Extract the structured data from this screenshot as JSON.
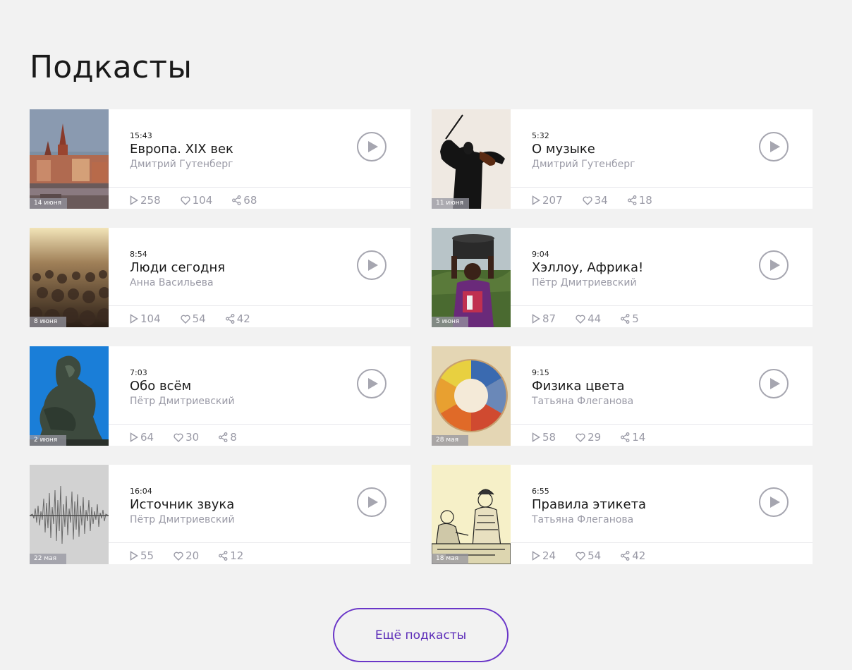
{
  "page": {
    "title": "Подкасты"
  },
  "podcasts": [
    {
      "duration": "15:43",
      "title": "Европа. XIX век",
      "author": "Дмитрий Гутенберг",
      "date": "14 июня",
      "plays": "258",
      "likes": "104",
      "shares": "68",
      "thumb": "city"
    },
    {
      "duration": "5:32",
      "title": "О музыке",
      "author": "Дмитрий Гутенберг",
      "date": "11 июня",
      "plays": "207",
      "likes": "34",
      "shares": "18",
      "thumb": "violinist"
    },
    {
      "duration": "8:54",
      "title": "Люди сегодня",
      "author": "Анна Васильева",
      "date": "8 июня",
      "plays": "104",
      "likes": "54",
      "shares": "42",
      "thumb": "crowd"
    },
    {
      "duration": "9:04",
      "title": "Хэллоу, Африка!",
      "author": "Пётр Дмитриевский",
      "date": "5 июня",
      "plays": "87",
      "likes": "44",
      "shares": "5",
      "thumb": "africa"
    },
    {
      "duration": "7:03",
      "title": "Обо всём",
      "author": "Пётр Дмитриевский",
      "date": "2 июня",
      "plays": "64",
      "likes": "30",
      "shares": "8",
      "thumb": "thinker"
    },
    {
      "duration": "9:15",
      "title": "Физика цвета",
      "author": "Татьяна Флеганова",
      "date": "28 мая",
      "plays": "58",
      "likes": "29",
      "shares": "14",
      "thumb": "colorwheel"
    },
    {
      "duration": "16:04",
      "title": "Источник звука",
      "author": "Пётр Дмитриевский",
      "date": "22 мая",
      "plays": "55",
      "likes": "20",
      "shares": "12",
      "thumb": "soundwave"
    },
    {
      "duration": "6:55",
      "title": "Правила этикета",
      "author": "Татьяна Флеганова",
      "date": "18 мая",
      "plays": "24",
      "likes": "54",
      "shares": "42",
      "thumb": "etiquette"
    }
  ],
  "more_button": {
    "label": "Ещё подкасты"
  },
  "colors": {
    "background": "#f2f2f2",
    "accent": "#6a36c8",
    "muted": "#9a9aa6"
  }
}
